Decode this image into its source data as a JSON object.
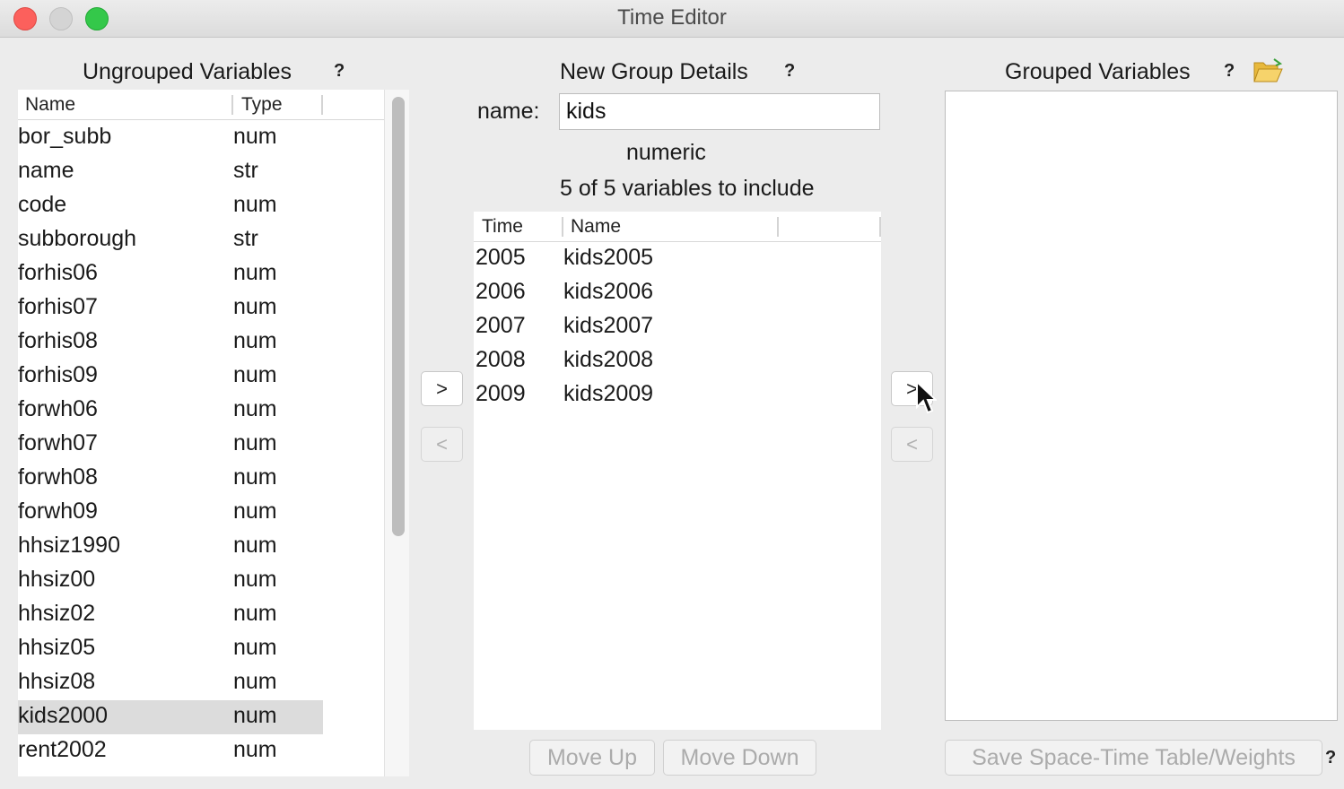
{
  "window": {
    "title": "Time Editor"
  },
  "ungrouped": {
    "title": "Ungrouped Variables",
    "help": "?",
    "columns": [
      "Name",
      "Type"
    ],
    "rows": [
      {
        "name": "bor_subb",
        "type": "num"
      },
      {
        "name": "name",
        "type": "str"
      },
      {
        "name": "code",
        "type": "num"
      },
      {
        "name": "subborough",
        "type": "str"
      },
      {
        "name": "forhis06",
        "type": "num"
      },
      {
        "name": "forhis07",
        "type": "num"
      },
      {
        "name": "forhis08",
        "type": "num"
      },
      {
        "name": "forhis09",
        "type": "num"
      },
      {
        "name": "forwh06",
        "type": "num"
      },
      {
        "name": "forwh07",
        "type": "num"
      },
      {
        "name": "forwh08",
        "type": "num"
      },
      {
        "name": "forwh09",
        "type": "num"
      },
      {
        "name": "hhsiz1990",
        "type": "num"
      },
      {
        "name": "hhsiz00",
        "type": "num"
      },
      {
        "name": "hhsiz02",
        "type": "num"
      },
      {
        "name": "hhsiz05",
        "type": "num"
      },
      {
        "name": "hhsiz08",
        "type": "num"
      },
      {
        "name": "kids2000",
        "type": "num"
      },
      {
        "name": "rent2002",
        "type": "num"
      }
    ],
    "selected_row": 17
  },
  "transfer_left": {
    "add_label": ">",
    "remove_label": "<"
  },
  "new_group": {
    "title": "New Group Details",
    "help": "?",
    "name_label": "name:",
    "name_value": "kids",
    "data_type": "numeric",
    "include_text": "5 of 5 variables to include",
    "columns": [
      "Time",
      "Name"
    ],
    "rows": [
      {
        "time": "2005",
        "name": "kids2005"
      },
      {
        "time": "2006",
        "name": "kids2006"
      },
      {
        "time": "2007",
        "name": "kids2007"
      },
      {
        "time": "2008",
        "name": "kids2008"
      },
      {
        "time": "2009",
        "name": "kids2009"
      }
    ],
    "move_up": "Move Up",
    "move_down": "Move Down"
  },
  "transfer_right": {
    "add_label": ">",
    "remove_label": "<"
  },
  "grouped": {
    "title": "Grouped Variables",
    "help": "?",
    "icon": "folder-open-icon",
    "save_button": "Save Space-Time Table/Weights",
    "save_help": "?"
  },
  "colors": {
    "selected_row": "#dcdcdc",
    "close": "#fc605c",
    "maximize": "#34c84a"
  }
}
